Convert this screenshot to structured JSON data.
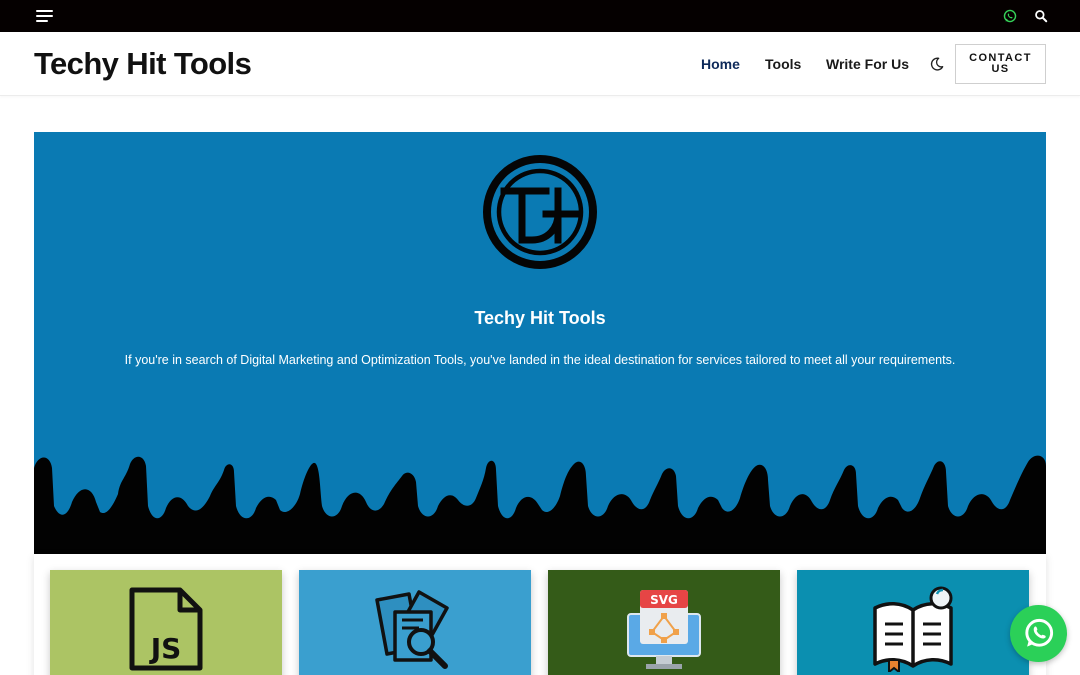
{
  "site": {
    "name": "Techy Hit Tools"
  },
  "nav": {
    "items": [
      {
        "label": "Home",
        "active": true
      },
      {
        "label": "Tools",
        "active": false
      },
      {
        "label": "Write For Us",
        "active": false
      }
    ],
    "contact_label": "CONTACT US"
  },
  "icons": {
    "menu": "hamburger-menu-icon",
    "whatsapp": "whatsapp-icon",
    "search": "search-icon",
    "theme_toggle": "moon-icon"
  },
  "hero": {
    "logo_letters": "TH",
    "title": "Techy Hit Tools",
    "description": "If you're in search of Digital Marketing and Optimization Tools, you've landed in the ideal destination for services tailored to meet all your requirements."
  },
  "cards": [
    {
      "icon": "js-file-icon",
      "icon_text": "JS",
      "color": "#acc464"
    },
    {
      "icon": "document-search-icon",
      "color": "#3a9fcf"
    },
    {
      "icon": "svg-monitor-icon",
      "icon_text": "SVG",
      "color": "#345b18"
    },
    {
      "icon": "open-book-icon",
      "color": "#0b8fb0"
    }
  ],
  "colors": {
    "topbar": "#050000",
    "hero": "#0a7ab3",
    "accent_nav": "#0e2a5a",
    "whatsapp": "#2bd058"
  }
}
